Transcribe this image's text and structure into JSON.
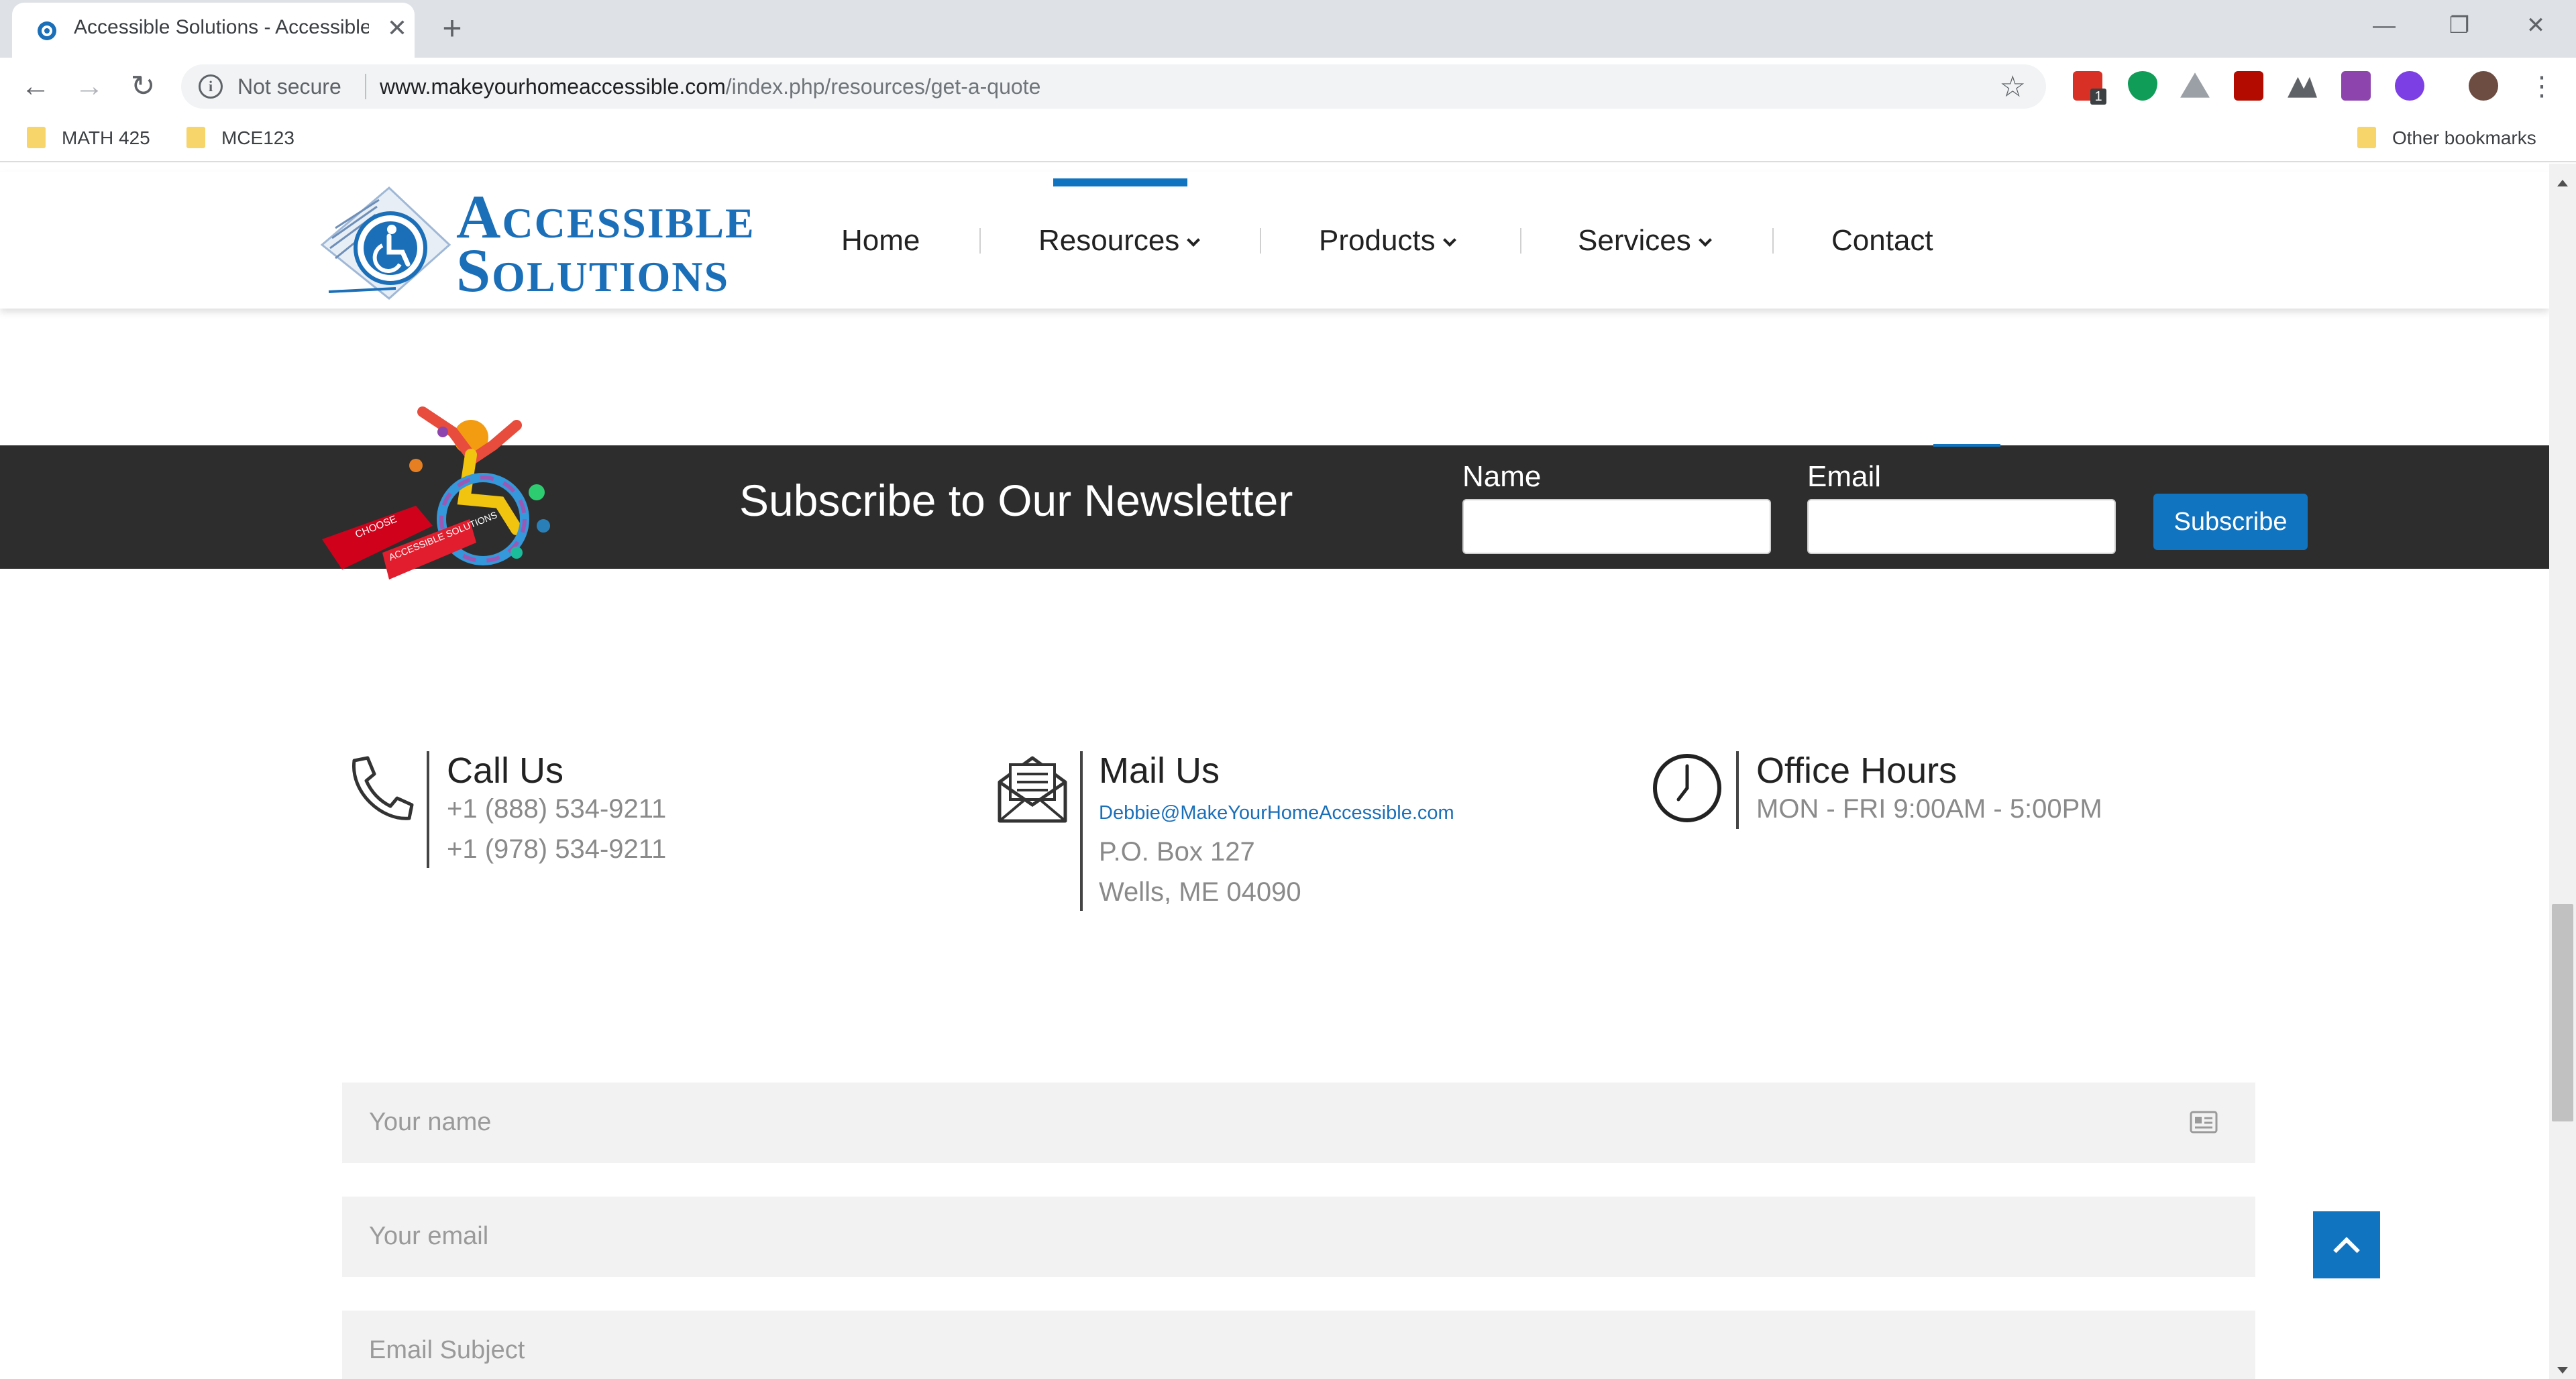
{
  "browser": {
    "tab_title": "Accessible Solutions - Accessible",
    "tab_close": "✕",
    "new_tab": "+",
    "security_label": "Not secure",
    "url_host": "www.makeyourhomeaccessible.com",
    "url_path": "/index.php/resources/get-a-quote",
    "extension_badge": "1",
    "bookmarks": [
      "MATH 425",
      "MCE123"
    ],
    "other_bookmarks": "Other bookmarks"
  },
  "site": {
    "logo_line1": "Accessible",
    "logo_line2": "Solutions",
    "nav": {
      "home": "Home",
      "resources": "Resources",
      "products": "Products",
      "services": "Services",
      "contact": "Contact"
    },
    "mascot_ribbon_1": "CHOOSE",
    "mascot_ribbon_2": "ACCESSIBLE SOLUTIONS"
  },
  "newsletter": {
    "heading": "Subscribe to Our Newsletter",
    "name_label": "Name",
    "email_label": "Email",
    "button": "Subscribe"
  },
  "contact": {
    "call": {
      "title": "Call Us",
      "phone1": "+1 (888) 534-9211",
      "phone2": "+1 (978) 534-9211"
    },
    "mail": {
      "title": "Mail Us",
      "email": "Debbie@MakeYourHomeAccessible.com",
      "address1": "P.O. Box 127",
      "address2": "Wells, ME 04090"
    },
    "hours": {
      "title": "Office Hours",
      "text": "MON - FRI 9:00AM - 5:00PM"
    }
  },
  "form": {
    "name_placeholder": "Your name",
    "email_placeholder": "Your email",
    "subject_placeholder": "Email Subject"
  },
  "colors": {
    "brand_blue": "#1174c0",
    "newsletter_bg": "#2d2d2d"
  },
  "icons": [
    "favicon-icon",
    "back-arrow-icon",
    "forward-arrow-icon",
    "reload-icon",
    "info-icon",
    "bookmark-star-icon",
    "phone-icon",
    "envelope-icon",
    "clock-icon",
    "id-card-icon",
    "chevron-up-icon"
  ]
}
